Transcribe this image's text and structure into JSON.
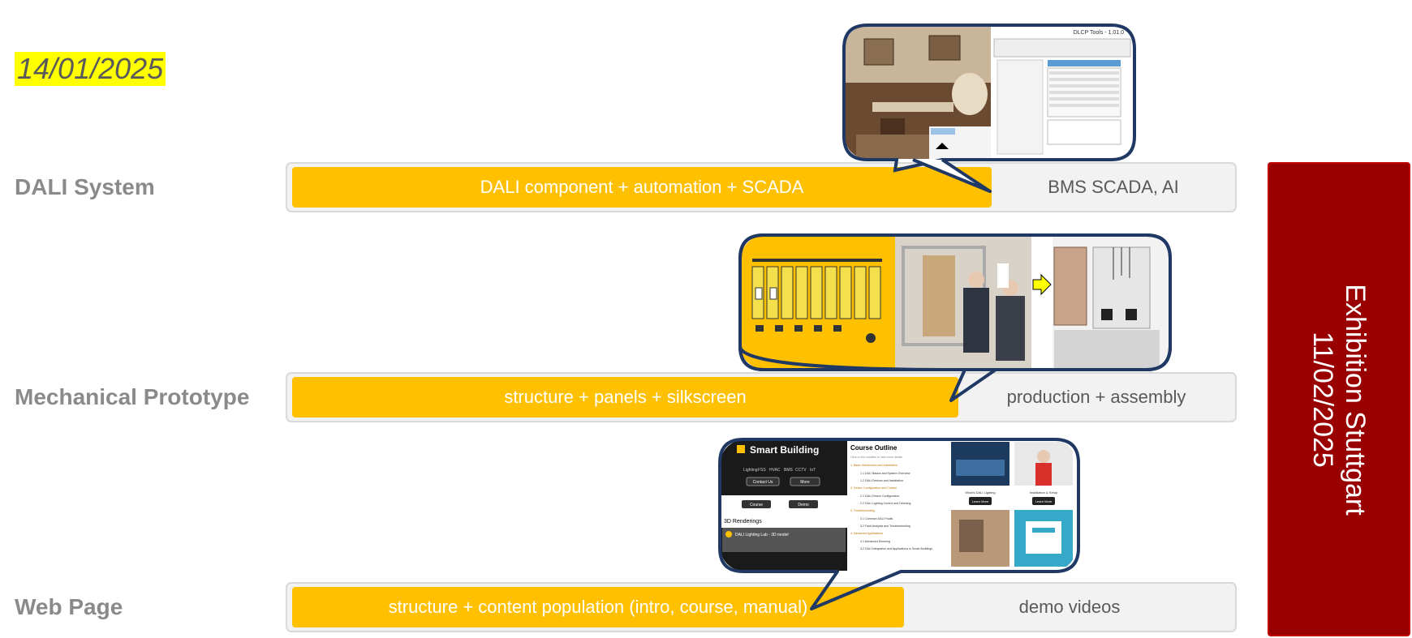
{
  "date": "14/01/2025",
  "rows": [
    {
      "label": "DALI System",
      "bar": "DALI component + automation + SCADA",
      "rest": "BMS SCADA, AI"
    },
    {
      "label": "Mechanical Prototype",
      "bar": "structure + panels + silkscreen",
      "rest": "production + assembly"
    },
    {
      "label": "Web Page",
      "bar": "structure + content population (intro, course, manual)",
      "rest": "demo videos"
    }
  ],
  "exhibition": {
    "line1": "Exhibition Stuttgart",
    "line2": "11/02/2025"
  },
  "callouts": {
    "dali": {
      "window_title": "DLCP Tools - 1.01.0"
    },
    "web": {
      "brand": "Smart Building",
      "nav": [
        "Lighting",
        "FSS",
        "HVAC",
        "BMS",
        "CCTV",
        "IoT"
      ],
      "buttons": [
        "Contact Us",
        "More",
        "Course",
        "Demo"
      ],
      "renderings_title": "3D Renderings",
      "video_title": "DALI Lighting Lab - 3D model",
      "outline_title": "Course Outline",
      "outline_hint": "Click on the subtitles to view more details",
      "outline_items": [
        "1. Basic Introduction and Installation",
        "1.1 DALI Basics and System Overview",
        "1.2 DALI Devices and Installation",
        "2. Device Configuration and Control",
        "2.1 DALI Device Configuration",
        "2.2 DALI Lighting Control and Dimming",
        "3. Troubleshooting",
        "3.1 Common DALI Faults",
        "3.2 Fault Analysis and Troubleshooting",
        "4. Advanced Applications",
        "4.1 Advanced Dimming",
        "4.2 DALI Integration and Applications in Smart Buildings"
      ],
      "card_captions": [
        "What's DALI Lighting",
        "Installation & Setup"
      ],
      "learn_more": "Learn More"
    }
  },
  "colors": {
    "bar": "#ffc000",
    "exhibition": "#990000",
    "callout_border": "#1f3864",
    "date_highlight": "#ffff00"
  }
}
